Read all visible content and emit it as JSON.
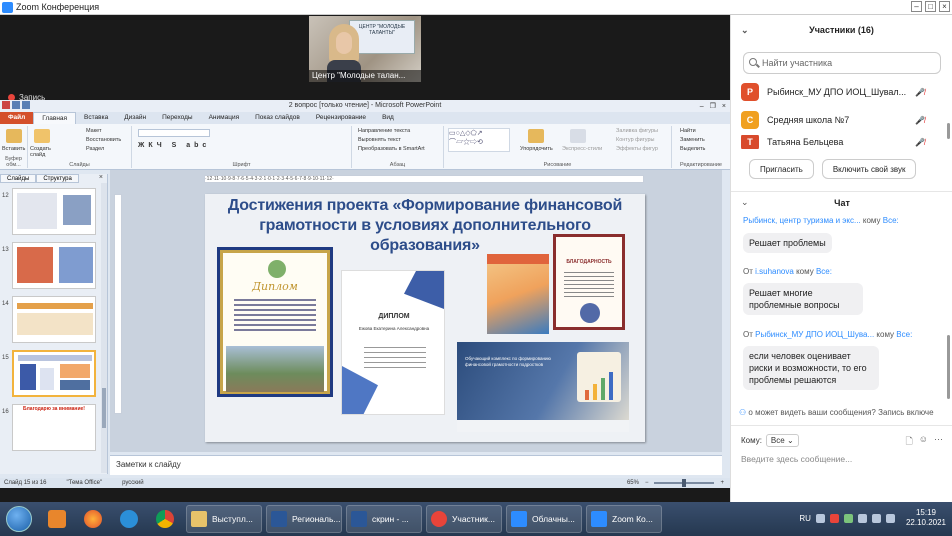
{
  "window": {
    "title": "Zoom Конференция"
  },
  "video": {
    "participant_label": "Центр \"Молодые талан...",
    "banner_text": "ЦЕНТР \"МОЛОДЫЕ ТАЛАНТЫ\"",
    "recording_label": "Запись"
  },
  "ppt": {
    "title": "2 вопрос [только чтение] - Microsoft PowerPoint",
    "tabs": [
      "Файл",
      "Главная",
      "Вставка",
      "Дизайн",
      "Переходы",
      "Анимация",
      "Показ слайдов",
      "Рецензирование",
      "Вид"
    ],
    "ribbon": {
      "paste": "Вставить",
      "clipboard": "Буфер обм...",
      "create_slide": "Создать слайд",
      "layout": "Макет",
      "reset": "Восстановить",
      "section": "Раздел",
      "slides_group": "Слайды",
      "font_group": "Шрифт",
      "text_dir": "Направление текста",
      "align_text": "Выровнять текст",
      "smartart": "Преобразовать в SmartArt",
      "paragraph_group": "Абзац",
      "arrange": "Упорядочить",
      "quick_styles": "Экспресс-стили",
      "fill": "Заливка фигуры",
      "outline": "Контур фигуры",
      "effects": "Эффекты фигур",
      "drawing_group": "Рисование",
      "find": "Найти",
      "replace": "Заменить",
      "select": "Выделить",
      "editing_group": "Редактирование"
    },
    "panel_tabs": [
      "Слайды",
      "Структура"
    ],
    "thumbnails": [
      {
        "num": "12",
        "title": ""
      },
      {
        "num": "13",
        "title": ""
      },
      {
        "num": "14",
        "title": ""
      },
      {
        "num": "15",
        "title": ""
      },
      {
        "num": "16",
        "title": "Благодарю за внимание!"
      }
    ],
    "slide": {
      "title": "Достижения проекта «Формирование финансовой грамотности в условиях дополнительного образования»",
      "diploma1_title": "Диплом",
      "diploma2_title": "ДИПЛОМ",
      "diploma2_name": "Ежова Екатерина Александровна",
      "thanks_title": "БЛАГОДАРНОСТЬ",
      "banner_text": "Обучающий комплекс по формированию финансовой грамотности подростков"
    },
    "notes_placeholder": "Заметки к слайду",
    "status": {
      "slide": "Слайд 15 из 16",
      "theme": "\"Тема Office\"",
      "lang": "русский",
      "zoom": "65%"
    }
  },
  "participants": {
    "header": "Участники (16)",
    "search_placeholder": "Найти участника",
    "list": [
      {
        "initial": "Р",
        "name": "Рыбинск_МУ ДПО ИОЦ_Шувал...",
        "color": "#e0502c"
      },
      {
        "initial": "С",
        "name": "Средняя школа №7",
        "color": "#f0a020"
      },
      {
        "initial": "Т",
        "name": "Татьяна Бельцева",
        "color": "#d84a2c"
      }
    ],
    "invite_button": "Пригласить",
    "unmute_button": "Включить свой звук"
  },
  "chat": {
    "header": "Чат",
    "messages": [
      {
        "from": "Рыбинск, центр туризма и экс...",
        "to_prefix": "кому",
        "to": "Все:",
        "text": "Решает проблемы"
      },
      {
        "from_prefix": "От",
        "from": "i.suhanova",
        "to_prefix": "кому",
        "to": "Все:",
        "text": "Решает многие проблемные вопросы"
      },
      {
        "from_prefix": "От",
        "from": "Рыбинск_МУ ДПО ИОЦ_Шува...",
        "to_prefix": "кому",
        "to": "Все:",
        "text": "если человек оценивает риски и возможности, то его проблемы решаются"
      }
    ],
    "visibility_note": "о может видеть ваши сообщения? Запись включе",
    "to_label": "Кому:",
    "to_value": "Все",
    "input_placeholder": "Введите здесь сообщение..."
  },
  "taskbar": {
    "tasks": [
      "Выступл...",
      "Региональ...",
      "скрин - ...",
      "Участник...",
      "Облачны...",
      "Zoom Ко..."
    ],
    "lang": "RU",
    "time": "15:19",
    "date": "22.10.2021"
  },
  "colors": {
    "zoom_blue": "#2d8cff",
    "ppt_file_tab": "#d4502b",
    "slide_title": "#2d4d8a"
  }
}
